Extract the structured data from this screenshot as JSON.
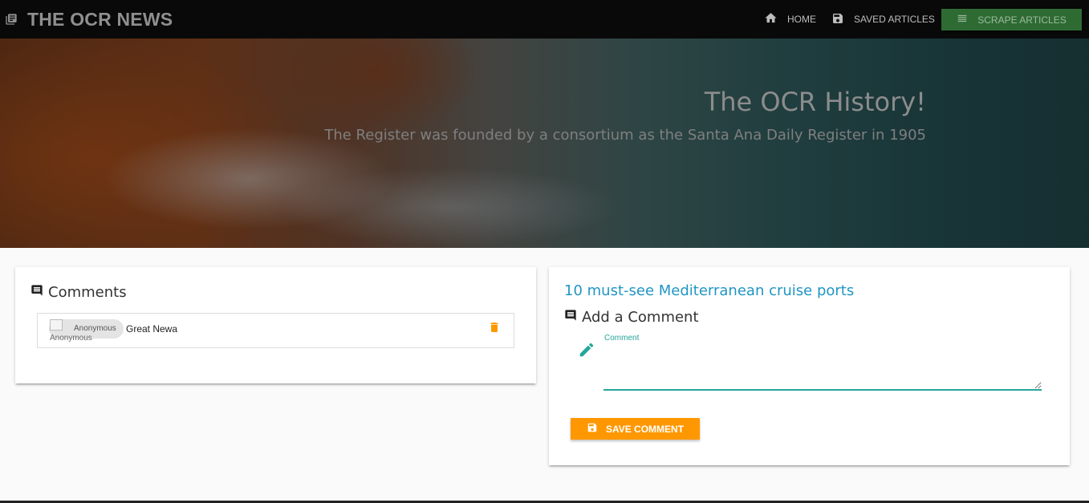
{
  "navbar": {
    "brand": "THE OCR NEWS",
    "brand_icon": "newspaper-icon",
    "links": [
      {
        "label": "HOME",
        "icon": "home-icon"
      },
      {
        "label": "SAVED ARTICLES",
        "icon": "save-icon"
      },
      {
        "label": "SCRAPE ARTICLES",
        "icon": "list-icon"
      }
    ],
    "scrape_color": "#2e6b33"
  },
  "hero": {
    "title": "The OCR History!",
    "subtitle": "The Register was founded by a consortium as the Santa Ana Daily Register in 1905"
  },
  "comments_card": {
    "header": "Comments",
    "header_icon": "comment-icon",
    "items": [
      {
        "author": "Anonymous",
        "avatar_alt": "Anonymous",
        "text": "Great Newa",
        "delete_icon": "trash-icon"
      }
    ]
  },
  "article_card": {
    "title": "10 must-see Mediterranean cruise ports",
    "add_comment_header": "Add a Comment",
    "field_label": "Comment",
    "field_value": "",
    "save_label": "SAVE COMMENT",
    "accent_color": "#26a69a",
    "button_color": "#ff9800",
    "link_color": "#2196c4"
  }
}
